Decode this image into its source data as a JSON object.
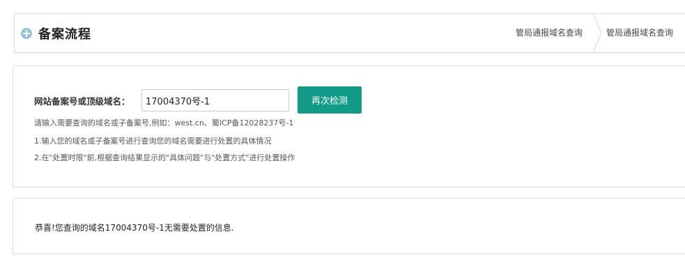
{
  "header": {
    "title": "备案流程",
    "breadcrumbs": [
      "管局通报域名查询",
      "管局通报域名查询"
    ]
  },
  "search": {
    "label": "网站备案号或顶级域名：",
    "value": "17004370号-1",
    "button_label": "再次检测",
    "hints": [
      "请输入需要查询的域名或子备案号,例如：west.cn、蜀ICP备12028237号-1",
      "1.输入您的域名或子备案号进行查询您的域名需要进行处置的具体情况",
      "2.在\"处置时限\"前,根据查询结果显示的\"具体问题\"与\"处置方式\"进行处置操作"
    ]
  },
  "result": {
    "message": "恭喜!您查询的域名17004370号-1无需要处置的信息."
  },
  "colors": {
    "accent": "#139b8a",
    "icon": "#9ac3d9"
  },
  "icons": {
    "title_icon": "plus-circle-icon",
    "breadcrumb_separator": "chevron-right-icon"
  }
}
